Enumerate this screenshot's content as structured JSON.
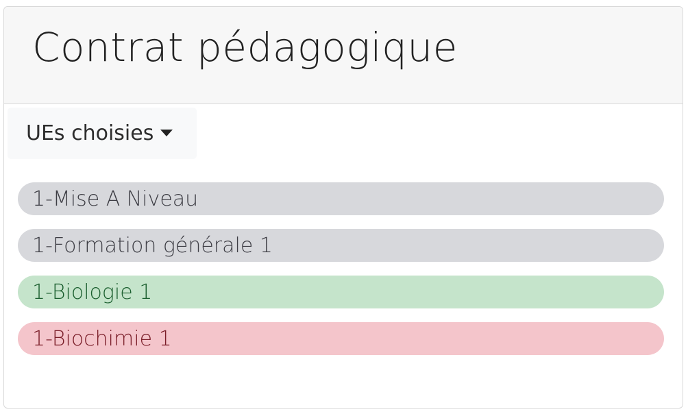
{
  "header": {
    "title": "Contrat pédagogique"
  },
  "dropdown": {
    "label": "UEs choisies",
    "icon": "caret-down-icon"
  },
  "ue_list": {
    "items": [
      {
        "label": "1-Mise A Niveau",
        "status": "secondary",
        "color": "#d7d8dc"
      },
      {
        "label": "1-Formation générale 1",
        "status": "secondary",
        "color": "#d7d8dc"
      },
      {
        "label": "1-Biologie 1",
        "status": "success",
        "color": "#c5e4cb"
      },
      {
        "label": "1-Biochimie 1",
        "status": "danger",
        "color": "#f4c5cb"
      }
    ]
  }
}
